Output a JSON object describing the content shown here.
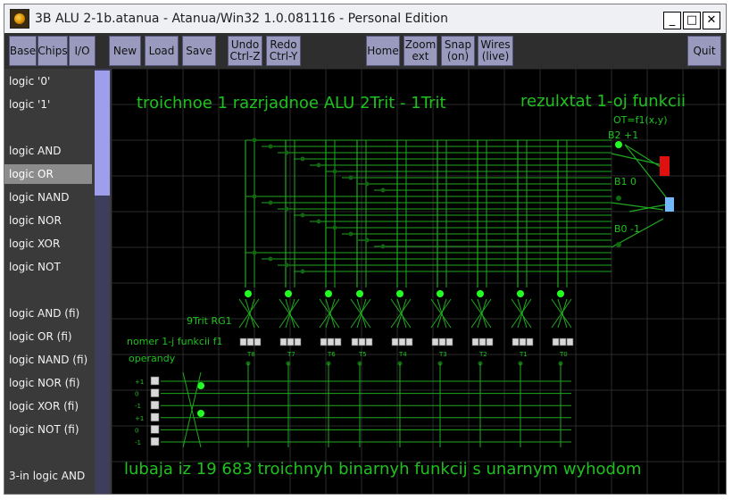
{
  "window": {
    "title": "3B ALU 2-1b.atanua - Atanua/Win32 1.0.081116 - Personal Edition",
    "controls": {
      "minimize": "_",
      "maximize": "□",
      "close": "✕"
    }
  },
  "toolbar": {
    "base": "Base",
    "chips": "Chips",
    "io": "I/O",
    "new": "New",
    "load": "Load",
    "save": "Save",
    "undo": "Undo\nCtrl-Z",
    "redo": "Redo\nCtrl-Y",
    "home": "Home",
    "zoom": "Zoom\next",
    "snap": "Snap\n(on)",
    "wires": "Wires\n(live)",
    "quit": "Quit"
  },
  "sidebar": {
    "items": [
      "logic '0'",
      "logic '1'",
      "logic AND",
      "logic OR",
      "logic NAND",
      "logic NOR",
      "logic XOR",
      "logic NOT",
      "logic AND (fi)",
      "logic OR (fi)",
      "logic NAND (fi)",
      "logic NOR (fi)",
      "logic XOR (fi)",
      "logic NOT (fi)",
      "3-in logic AND"
    ],
    "selected": "logic OR"
  },
  "canvas": {
    "title_main": "troichnoe 1 razrjadnoe ALU 2Trit - 1Trit",
    "title_result": "rezulxtat 1-oj funkcii",
    "result_formula": "OT=f1(x,y)",
    "reg_label": "9Trit RG1",
    "func_label": "nomer 1-j funkcii f1",
    "operands_label": "operandy",
    "bottom_text": "lubaja iz 19 683 troichnyh binarnyh funkcij s unarnym wyhodom",
    "out_b2": "B2  +1",
    "out_b1": "B1  0",
    "out_b0": "B0 -1",
    "trit_labels": [
      "T8",
      "T7",
      "T6",
      "T5",
      "T4",
      "T3",
      "T2",
      "T1",
      "T0"
    ],
    "operand_values": [
      "+1",
      "0",
      "-1",
      "+1",
      "0",
      "-1"
    ],
    "colors": {
      "grid": "#2a2a2a",
      "wire": "#1fa81f",
      "text": "#1ec21e",
      "led_on": "#22ff22",
      "led_red": "#e01010",
      "led_blue": "#70b8ff"
    }
  }
}
